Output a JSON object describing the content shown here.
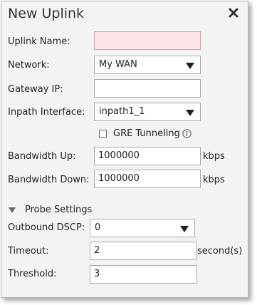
{
  "dialog": {
    "title": "New Uplink"
  },
  "form": {
    "uplink_name": {
      "label": "Uplink Name:",
      "value": ""
    },
    "network": {
      "label": "Network:",
      "value": "My WAN"
    },
    "gateway_ip": {
      "label": "Gateway IP:",
      "value": ""
    },
    "inpath_interface": {
      "label": "Inpath Interface:",
      "value": "inpath1_1"
    },
    "gre_tunneling": {
      "label": "GRE Tunneling",
      "checked": false
    },
    "bandwidth_up": {
      "label": "Bandwidth Up:",
      "value": "1000000",
      "unit": "kbps"
    },
    "bandwidth_down": {
      "label": "Bandwidth Down:",
      "value": "1000000",
      "unit": "kbps"
    }
  },
  "probe": {
    "section_label": "Probe Settings",
    "outbound_dscp": {
      "label": "Outbound DSCP:",
      "value": "0"
    },
    "timeout": {
      "label": "Timeout:",
      "value": "2",
      "unit": "second(s)"
    },
    "threshold": {
      "label": "Threshold:",
      "value": "3"
    }
  },
  "icons": {
    "close": "close-icon",
    "info": "info-icon",
    "dropdown": "chevron-down-icon",
    "collapse": "caret-down-icon"
  }
}
